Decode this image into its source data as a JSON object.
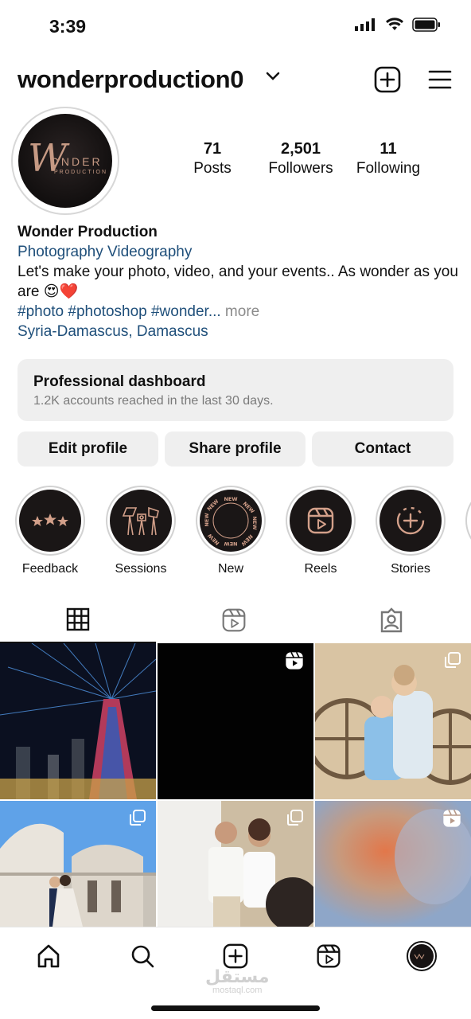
{
  "status_bar": {
    "time": "3:39"
  },
  "header": {
    "username": "wonderproduction0"
  },
  "avatar": {
    "logo_line1": "W",
    "logo_line2": "ONDER",
    "logo_line3": "PRODUCTION"
  },
  "stats": [
    {
      "value": "71",
      "label": "Posts"
    },
    {
      "value": "2,501",
      "label": "Followers"
    },
    {
      "value": "11",
      "label": "Following"
    }
  ],
  "bio": {
    "name": "Wonder Production",
    "category": "Photography Videography",
    "text": "Let's make your photo, video, and your events.. As wonder as you are 😍❤️",
    "hashtags": "#photo #photoshop #wonder...",
    "more": " more",
    "location": "Syria-Damascus, Damascus"
  },
  "dashboard": {
    "title": "Professional dashboard",
    "subtitle": "1.2K accounts reached in the last 30 days."
  },
  "buttons": {
    "edit": "Edit profile",
    "share": "Share profile",
    "contact": "Contact"
  },
  "highlights": [
    {
      "label": "Feedback",
      "icon": "stars-icon"
    },
    {
      "label": "Sessions",
      "icon": "studio-icon"
    },
    {
      "label": "New",
      "icon": "new-badge-icon"
    },
    {
      "label": "Reels",
      "icon": "reels-icon"
    },
    {
      "label": "Stories",
      "icon": "add-story-icon"
    }
  ],
  "tabs": [
    "grid-icon",
    "reels-icon",
    "tagged-icon"
  ],
  "grid_posts": [
    {
      "type": "photo",
      "description": "tower-light-show"
    },
    {
      "type": "reel",
      "description": "black-reel"
    },
    {
      "type": "carousel",
      "description": "children-hugging"
    },
    {
      "type": "carousel",
      "description": "couple-church"
    },
    {
      "type": "carousel",
      "description": "couple-portrait"
    },
    {
      "type": "reel",
      "description": "blurred-reel"
    }
  ],
  "bottom_nav": [
    "home-icon",
    "search-icon",
    "create-icon",
    "reels-icon",
    "profile-avatar"
  ],
  "watermark": {
    "arabic": "مستقل",
    "latin": "mostaql.com"
  },
  "colors": {
    "link": "#1f4f7a",
    "button_bg": "#efefef",
    "accent_gold": "#c69a84"
  }
}
